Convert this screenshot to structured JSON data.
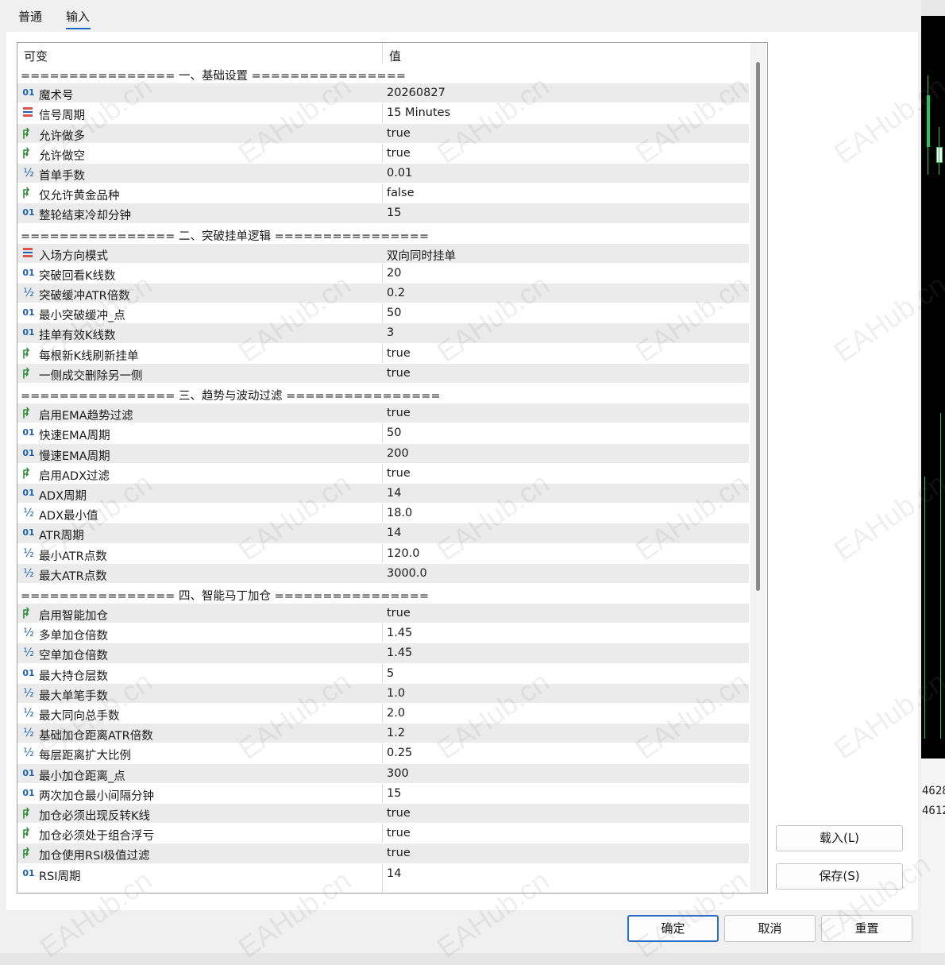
{
  "tabs": [
    "普通",
    "输入"
  ],
  "grid": {
    "header": {
      "col1": "可变",
      "col2": "值"
    },
    "rows": [
      {
        "type": "sep",
        "name": "================ 一、基础设置 ================",
        "value": ""
      },
      {
        "type": "int",
        "name": "魔术号",
        "value": "20260827"
      },
      {
        "type": "enum",
        "name": "信号周期",
        "value": "15 Minutes"
      },
      {
        "type": "bool",
        "name": "允许做多",
        "value": "true"
      },
      {
        "type": "bool",
        "name": "允许做空",
        "value": "true"
      },
      {
        "type": "dbl",
        "name": "首单手数",
        "value": "0.01"
      },
      {
        "type": "bool",
        "name": "仅允许黄金品种",
        "value": "false"
      },
      {
        "type": "int",
        "name": "整轮结束冷却分钟",
        "value": "15"
      },
      {
        "type": "sep",
        "name": "================ 二、突破挂单逻辑 ================",
        "value": ""
      },
      {
        "type": "enum",
        "name": "入场方向模式",
        "value": "双向同时挂单"
      },
      {
        "type": "int",
        "name": "突破回看K线数",
        "value": "20"
      },
      {
        "type": "dbl",
        "name": "突破缓冲ATR倍数",
        "value": "0.2"
      },
      {
        "type": "int",
        "name": "最小突破缓冲_点",
        "value": "50"
      },
      {
        "type": "int",
        "name": "挂单有效K线数",
        "value": "3"
      },
      {
        "type": "bool",
        "name": "每根新K线刷新挂单",
        "value": "true"
      },
      {
        "type": "bool",
        "name": "一侧成交删除另一侧",
        "value": "true"
      },
      {
        "type": "sep",
        "name": "================ 三、趋势与波动过滤 ================",
        "value": ""
      },
      {
        "type": "bool",
        "name": "启用EMA趋势过滤",
        "value": "true"
      },
      {
        "type": "int",
        "name": "快速EMA周期",
        "value": "50"
      },
      {
        "type": "int",
        "name": "慢速EMA周期",
        "value": "200"
      },
      {
        "type": "bool",
        "name": "启用ADX过滤",
        "value": "true"
      },
      {
        "type": "int",
        "name": "ADX周期",
        "value": "14"
      },
      {
        "type": "dbl",
        "name": "ADX最小值",
        "value": "18.0"
      },
      {
        "type": "int",
        "name": "ATR周期",
        "value": "14"
      },
      {
        "type": "dbl",
        "name": "最小ATR点数",
        "value": "120.0"
      },
      {
        "type": "dbl",
        "name": "最大ATR点数",
        "value": "3000.0"
      },
      {
        "type": "sep",
        "name": "================ 四、智能马丁加仓 ================",
        "value": ""
      },
      {
        "type": "bool",
        "name": "启用智能加仓",
        "value": "true"
      },
      {
        "type": "dbl",
        "name": "多单加仓倍数",
        "value": "1.45"
      },
      {
        "type": "dbl",
        "name": "空单加仓倍数",
        "value": "1.45"
      },
      {
        "type": "int",
        "name": "最大持仓层数",
        "value": "5"
      },
      {
        "type": "dbl",
        "name": "最大单笔手数",
        "value": "1.0"
      },
      {
        "type": "dbl",
        "name": "最大同向总手数",
        "value": "2.0"
      },
      {
        "type": "dbl",
        "name": "基础加仓距离ATR倍数",
        "value": "1.2"
      },
      {
        "type": "dbl",
        "name": "每层距离扩大比例",
        "value": "0.25"
      },
      {
        "type": "int",
        "name": "最小加仓距离_点",
        "value": "300"
      },
      {
        "type": "int",
        "name": "两次加仓最小间隔分钟",
        "value": "15"
      },
      {
        "type": "bool",
        "name": "加仓必须出现反转K线",
        "value": "true"
      },
      {
        "type": "bool",
        "name": "加仓必须处于组合浮亏",
        "value": "true"
      },
      {
        "type": "bool",
        "name": "加仓使用RSI极值过滤",
        "value": "true"
      },
      {
        "type": "int",
        "name": "RSI周期",
        "value": "14"
      }
    ]
  },
  "buttons": {
    "load": "载入(L)",
    "save": "保存(S)",
    "ok": "确定",
    "cancel": "取消",
    "reset": "重置"
  },
  "icons": {
    "int": "01",
    "dbl": "½",
    "bool": "green-arrow-icon",
    "enum": "list-icon"
  },
  "colors": {
    "int_icon": "#1c5fb8",
    "bool_icon": "#2e8b3a",
    "enum_icon": "#d9534f",
    "accent": "#2a6cc8"
  },
  "right_chart": {
    "prices": [
      "4628",
      "4612"
    ]
  },
  "watermark": "EAHub.cn"
}
